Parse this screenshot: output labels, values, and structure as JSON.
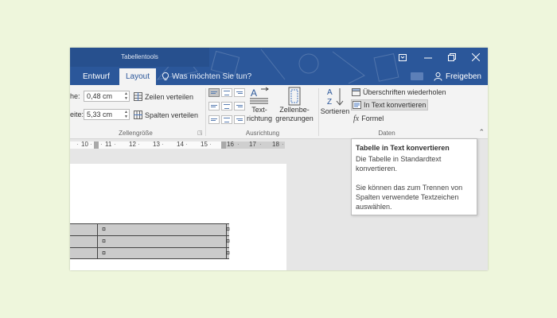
{
  "colors": {
    "accent": "#2b579a",
    "background": "#eef6dc"
  },
  "titlebar": {
    "context_title": "Tabellentools",
    "tabs": [
      {
        "label": "Entwurf",
        "active": false
      },
      {
        "label": "Layout",
        "active": true
      }
    ],
    "tell_me": "Was möchten Sie tun?",
    "share": "Freigeben",
    "window_buttons": [
      "ribbon-display-options-icon",
      "minimize-icon",
      "restore-icon",
      "close-icon"
    ]
  },
  "ribbon": {
    "cellsize": {
      "height_label": "he:",
      "height_value": "0,48 cm",
      "width_label": "eite:",
      "width_value": "5,33 cm",
      "distribute_rows": "Zeilen verteilen",
      "distribute_cols": "Spalten verteilen",
      "group_label": "Zellengröße"
    },
    "alignment": {
      "text_direction_l1": "Text-",
      "text_direction_l2": "richtung",
      "cell_margins_l1": "Zellenbe-",
      "cell_margins_l2": "grenzungen",
      "group_label": "Ausrichtung"
    },
    "data": {
      "sort": "Sortieren",
      "repeat_headers": "Überschriften wiederholen",
      "convert_to_text": "In Text konvertieren",
      "formula": "Formel",
      "group_label": "Daten"
    }
  },
  "ruler": {
    "ticks": [
      "10",
      "11",
      "12",
      "13",
      "14",
      "15",
      "16",
      "17",
      "18"
    ]
  },
  "doc": {
    "cell_mark": "¤",
    "row_mark": "¤"
  },
  "tooltip": {
    "title": "Tabelle in Text konvertieren",
    "p1": "Die Tabelle in Standardtext konvertieren.",
    "p2": "Sie können das zum Trennen von Spalten verwendete Textzeichen auswählen."
  }
}
